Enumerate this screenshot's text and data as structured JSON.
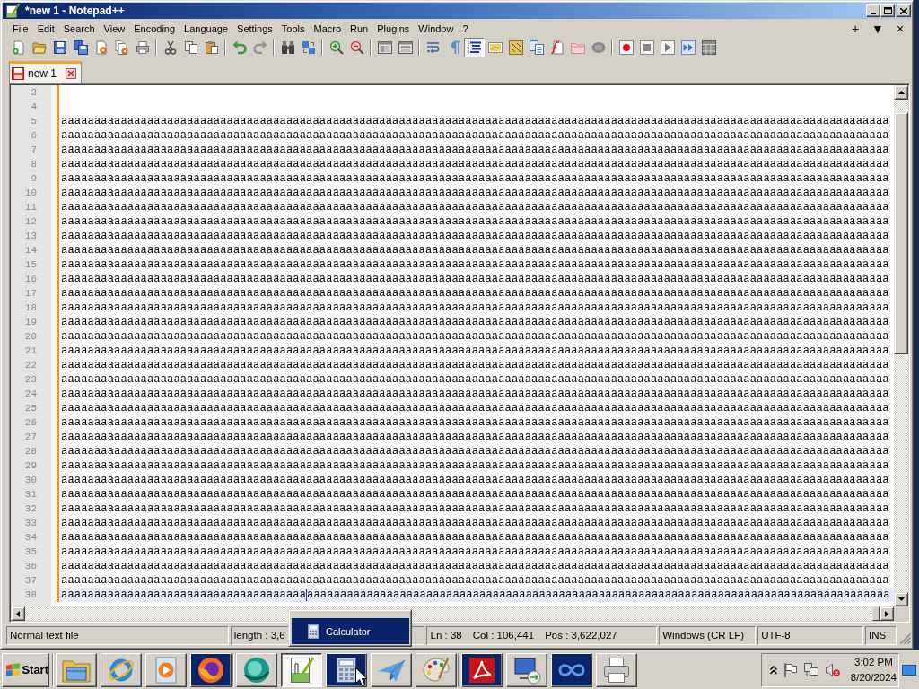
{
  "window": {
    "title": "*new 1 - Notepad++"
  },
  "menu": {
    "items": [
      "File",
      "Edit",
      "Search",
      "View",
      "Encoding",
      "Language",
      "Settings",
      "Tools",
      "Macro",
      "Run",
      "Plugins",
      "Window",
      "?"
    ],
    "tab_controls": [
      "+",
      "▼",
      "×"
    ]
  },
  "toolbar": {
    "groups": [
      [
        {
          "kind": "new",
          "disabled": false,
          "pressed": false
        },
        {
          "kind": "open",
          "disabled": false,
          "pressed": false
        },
        {
          "kind": "save",
          "disabled": false,
          "pressed": false
        },
        {
          "kind": "saveall",
          "disabled": false,
          "pressed": false
        },
        {
          "kind": "close",
          "disabled": false,
          "pressed": false
        },
        {
          "kind": "closeall",
          "disabled": false,
          "pressed": false
        },
        {
          "kind": "print",
          "disabled": false,
          "pressed": false
        }
      ],
      [
        {
          "kind": "cut",
          "disabled": false,
          "pressed": false
        },
        {
          "kind": "copy",
          "disabled": false,
          "pressed": false
        },
        {
          "kind": "paste",
          "disabled": false,
          "pressed": false
        }
      ],
      [
        {
          "kind": "undo",
          "disabled": false,
          "pressed": false
        },
        {
          "kind": "redo",
          "disabled": true,
          "pressed": false
        }
      ],
      [
        {
          "kind": "find",
          "disabled": false,
          "pressed": false
        },
        {
          "kind": "replace",
          "disabled": false,
          "pressed": false
        }
      ],
      [
        {
          "kind": "zoomin",
          "disabled": false,
          "pressed": false
        },
        {
          "kind": "zoomout",
          "disabled": false,
          "pressed": false
        }
      ],
      [
        {
          "kind": "syncv",
          "disabled": false,
          "pressed": false
        },
        {
          "kind": "synch",
          "disabled": false,
          "pressed": false
        }
      ],
      [
        {
          "kind": "wrap",
          "disabled": false,
          "pressed": false
        },
        {
          "kind": "allchars",
          "disabled": false,
          "pressed": false
        },
        {
          "kind": "indent",
          "disabled": false,
          "pressed": true
        },
        {
          "kind": "udl",
          "disabled": false,
          "pressed": false
        },
        {
          "kind": "docmap",
          "disabled": false,
          "pressed": false
        },
        {
          "kind": "doclist",
          "disabled": false,
          "pressed": false
        },
        {
          "kind": "funclist",
          "disabled": false,
          "pressed": false
        },
        {
          "kind": "workspace",
          "disabled": false,
          "pressed": false
        },
        {
          "kind": "monitor",
          "disabled": false,
          "pressed": false
        }
      ],
      [
        {
          "kind": "record",
          "disabled": false,
          "pressed": false
        },
        {
          "kind": "stop",
          "disabled": false,
          "pressed": false
        },
        {
          "kind": "play",
          "disabled": false,
          "pressed": false
        },
        {
          "kind": "playmulti",
          "disabled": false,
          "pressed": false
        },
        {
          "kind": "savemacro",
          "disabled": false,
          "pressed": false
        }
      ]
    ]
  },
  "tabs": [
    {
      "label": "new 1",
      "selected": true,
      "modified": true
    }
  ],
  "editor": {
    "lines": [
      {
        "number": "3",
        "modified": true,
        "current": false
      },
      {
        "number": "4",
        "modified": true,
        "current": false
      },
      {
        "number": "5",
        "text": "aaaaaaaaaaaaaaaaaaaaaaaaaaaaaaaaaaaaaaaaaaaaaaaaaaaaaaaaaaaaaaaaaaaaaaaaaaaaaaaaaaaaaaaaaaaaaaaaaaaaaaaaaaaaaaaaaaaaaaaaaaaaa",
        "modified": true,
        "current": false
      },
      {
        "number": "6",
        "text": "aaaaaaaaaaaaaaaaaaaaaaaaaaaaaaaaaaaaaaaaaaaaaaaaaaaaaaaaaaaaaaaaaaaaaaaaaaaaaaaaaaaaaaaaaaaaaaaaaaaaaaaaaaaaaaaaaaaaaaaaaaaaa",
        "modified": true,
        "current": false
      },
      {
        "number": "7",
        "text": "aaaaaaaaaaaaaaaaaaaaaaaaaaaaaaaaaaaaaaaaaaaaaaaaaaaaaaaaaaaaaaaaaaaaaaaaaaaaaaaaaaaaaaaaaaaaaaaaaaaaaaaaaaaaaaaaaaaaaaaaaaaaa",
        "modified": true,
        "current": false
      },
      {
        "number": "8",
        "text": "aaaaaaaaaaaaaaaaaaaaaaaaaaaaaaaaaaaaaaaaaaaaaaaaaaaaaaaaaaaaaaaaaaaaaaaaaaaaaaaaaaaaaaaaaaaaaaaaaaaaaaaaaaaaaaaaaaaaaaaaaaaaa",
        "modified": true,
        "current": false
      },
      {
        "number": "9",
        "text": "aaaaaaaaaaaaaaaaaaaaaaaaaaaaaaaaaaaaaaaaaaaaaaaaaaaaaaaaaaaaaaaaaaaaaaaaaaaaaaaaaaaaaaaaaaaaaaaaaaaaaaaaaaaaaaaaaaaaaaaaaaaaa",
        "modified": true,
        "current": false
      },
      {
        "number": "10",
        "text": "aaaaaaaaaaaaaaaaaaaaaaaaaaaaaaaaaaaaaaaaaaaaaaaaaaaaaaaaaaaaaaaaaaaaaaaaaaaaaaaaaaaaaaaaaaaaaaaaaaaaaaaaaaaaaaaaaaaaaaaaaaaaa",
        "modified": true,
        "current": false
      },
      {
        "number": "11",
        "text": "aaaaaaaaaaaaaaaaaaaaaaaaaaaaaaaaaaaaaaaaaaaaaaaaaaaaaaaaaaaaaaaaaaaaaaaaaaaaaaaaaaaaaaaaaaaaaaaaaaaaaaaaaaaaaaaaaaaaaaaaaaaaa",
        "modified": true,
        "current": false
      },
      {
        "number": "12",
        "text": "aaaaaaaaaaaaaaaaaaaaaaaaaaaaaaaaaaaaaaaaaaaaaaaaaaaaaaaaaaaaaaaaaaaaaaaaaaaaaaaaaaaaaaaaaaaaaaaaaaaaaaaaaaaaaaaaaaaaaaaaaaaaa",
        "modified": true,
        "current": false
      },
      {
        "number": "13",
        "text": "aaaaaaaaaaaaaaaaaaaaaaaaaaaaaaaaaaaaaaaaaaaaaaaaaaaaaaaaaaaaaaaaaaaaaaaaaaaaaaaaaaaaaaaaaaaaaaaaaaaaaaaaaaaaaaaaaaaaaaaaaaaaa",
        "modified": true,
        "current": false
      },
      {
        "number": "14",
        "text": "aaaaaaaaaaaaaaaaaaaaaaaaaaaaaaaaaaaaaaaaaaaaaaaaaaaaaaaaaaaaaaaaaaaaaaaaaaaaaaaaaaaaaaaaaaaaaaaaaaaaaaaaaaaaaaaaaaaaaaaaaaaaa",
        "modified": true,
        "current": false
      },
      {
        "number": "15",
        "text": "aaaaaaaaaaaaaaaaaaaaaaaaaaaaaaaaaaaaaaaaaaaaaaaaaaaaaaaaaaaaaaaaaaaaaaaaaaaaaaaaaaaaaaaaaaaaaaaaaaaaaaaaaaaaaaaaaaaaaaaaaaaaa",
        "modified": true,
        "current": false
      },
      {
        "number": "16",
        "text": "aaaaaaaaaaaaaaaaaaaaaaaaaaaaaaaaaaaaaaaaaaaaaaaaaaaaaaaaaaaaaaaaaaaaaaaaaaaaaaaaaaaaaaaaaaaaaaaaaaaaaaaaaaaaaaaaaaaaaaaaaaaaa",
        "modified": true,
        "current": false
      },
      {
        "number": "17",
        "text": "aaaaaaaaaaaaaaaaaaaaaaaaaaaaaaaaaaaaaaaaaaaaaaaaaaaaaaaaaaaaaaaaaaaaaaaaaaaaaaaaaaaaaaaaaaaaaaaaaaaaaaaaaaaaaaaaaaaaaaaaaaaaa",
        "modified": true,
        "current": false
      },
      {
        "number": "18",
        "text": "aaaaaaaaaaaaaaaaaaaaaaaaaaaaaaaaaaaaaaaaaaaaaaaaaaaaaaaaaaaaaaaaaaaaaaaaaaaaaaaaaaaaaaaaaaaaaaaaaaaaaaaaaaaaaaaaaaaaaaaaaaaaa",
        "modified": true,
        "current": false
      },
      {
        "number": "19",
        "text": "aaaaaaaaaaaaaaaaaaaaaaaaaaaaaaaaaaaaaaaaaaaaaaaaaaaaaaaaaaaaaaaaaaaaaaaaaaaaaaaaaaaaaaaaaaaaaaaaaaaaaaaaaaaaaaaaaaaaaaaaaaaaa",
        "modified": true,
        "current": false
      },
      {
        "number": "20",
        "text": "aaaaaaaaaaaaaaaaaaaaaaaaaaaaaaaaaaaaaaaaaaaaaaaaaaaaaaaaaaaaaaaaaaaaaaaaaaaaaaaaaaaaaaaaaaaaaaaaaaaaaaaaaaaaaaaaaaaaaaaaaaaaa",
        "modified": true,
        "current": false
      },
      {
        "number": "21",
        "text": "aaaaaaaaaaaaaaaaaaaaaaaaaaaaaaaaaaaaaaaaaaaaaaaaaaaaaaaaaaaaaaaaaaaaaaaaaaaaaaaaaaaaaaaaaaaaaaaaaaaaaaaaaaaaaaaaaaaaaaaaaaaaa",
        "modified": true,
        "current": false
      },
      {
        "number": "22",
        "text": "aaaaaaaaaaaaaaaaaaaaaaaaaaaaaaaaaaaaaaaaaaaaaaaaaaaaaaaaaaaaaaaaaaaaaaaaaaaaaaaaaaaaaaaaaaaaaaaaaaaaaaaaaaaaaaaaaaaaaaaaaaaaa",
        "modified": true,
        "current": false
      },
      {
        "number": "23",
        "text": "aaaaaaaaaaaaaaaaaaaaaaaaaaaaaaaaaaaaaaaaaaaaaaaaaaaaaaaaaaaaaaaaaaaaaaaaaaaaaaaaaaaaaaaaaaaaaaaaaaaaaaaaaaaaaaaaaaaaaaaaaaaaa",
        "modified": true,
        "current": false
      },
      {
        "number": "24",
        "text": "aaaaaaaaaaaaaaaaaaaaaaaaaaaaaaaaaaaaaaaaaaaaaaaaaaaaaaaaaaaaaaaaaaaaaaaaaaaaaaaaaaaaaaaaaaaaaaaaaaaaaaaaaaaaaaaaaaaaaaaaaaaaa",
        "modified": true,
        "current": false
      },
      {
        "number": "25",
        "text": "aaaaaaaaaaaaaaaaaaaaaaaaaaaaaaaaaaaaaaaaaaaaaaaaaaaaaaaaaaaaaaaaaaaaaaaaaaaaaaaaaaaaaaaaaaaaaaaaaaaaaaaaaaaaaaaaaaaaaaaaaaaaa",
        "modified": true,
        "current": false
      },
      {
        "number": "26",
        "text": "aaaaaaaaaaaaaaaaaaaaaaaaaaaaaaaaaaaaaaaaaaaaaaaaaaaaaaaaaaaaaaaaaaaaaaaaaaaaaaaaaaaaaaaaaaaaaaaaaaaaaaaaaaaaaaaaaaaaaaaaaaaaa",
        "modified": true,
        "current": false
      },
      {
        "number": "27",
        "text": "aaaaaaaaaaaaaaaaaaaaaaaaaaaaaaaaaaaaaaaaaaaaaaaaaaaaaaaaaaaaaaaaaaaaaaaaaaaaaaaaaaaaaaaaaaaaaaaaaaaaaaaaaaaaaaaaaaaaaaaaaaaaa",
        "modified": true,
        "current": false
      },
      {
        "number": "28",
        "text": "aaaaaaaaaaaaaaaaaaaaaaaaaaaaaaaaaaaaaaaaaaaaaaaaaaaaaaaaaaaaaaaaaaaaaaaaaaaaaaaaaaaaaaaaaaaaaaaaaaaaaaaaaaaaaaaaaaaaaaaaaaaaa",
        "modified": true,
        "current": false
      },
      {
        "number": "29",
        "text": "aaaaaaaaaaaaaaaaaaaaaaaaaaaaaaaaaaaaaaaaaaaaaaaaaaaaaaaaaaaaaaaaaaaaaaaaaaaaaaaaaaaaaaaaaaaaaaaaaaaaaaaaaaaaaaaaaaaaaaaaaaaaa",
        "modified": true,
        "current": false
      },
      {
        "number": "30",
        "text": "aaaaaaaaaaaaaaaaaaaaaaaaaaaaaaaaaaaaaaaaaaaaaaaaaaaaaaaaaaaaaaaaaaaaaaaaaaaaaaaaaaaaaaaaaaaaaaaaaaaaaaaaaaaaaaaaaaaaaaaaaaaaa",
        "modified": true,
        "current": false
      },
      {
        "number": "31",
        "text": "aaaaaaaaaaaaaaaaaaaaaaaaaaaaaaaaaaaaaaaaaaaaaaaaaaaaaaaaaaaaaaaaaaaaaaaaaaaaaaaaaaaaaaaaaaaaaaaaaaaaaaaaaaaaaaaaaaaaaaaaaaaaa",
        "modified": true,
        "current": false
      },
      {
        "number": "32",
        "text": "aaaaaaaaaaaaaaaaaaaaaaaaaaaaaaaaaaaaaaaaaaaaaaaaaaaaaaaaaaaaaaaaaaaaaaaaaaaaaaaaaaaaaaaaaaaaaaaaaaaaaaaaaaaaaaaaaaaaaaaaaaaaa",
        "modified": true,
        "current": false
      },
      {
        "number": "33",
        "text": "aaaaaaaaaaaaaaaaaaaaaaaaaaaaaaaaaaaaaaaaaaaaaaaaaaaaaaaaaaaaaaaaaaaaaaaaaaaaaaaaaaaaaaaaaaaaaaaaaaaaaaaaaaaaaaaaaaaaaaaaaaaaa",
        "modified": true,
        "current": false
      },
      {
        "number": "34",
        "text": "aaaaaaaaaaaaaaaaaaaaaaaaaaaaaaaaaaaaaaaaaaaaaaaaaaaaaaaaaaaaaaaaaaaaaaaaaaaaaaaaaaaaaaaaaaaaaaaaaaaaaaaaaaaaaaaaaaaaaaaaaaaaa",
        "modified": true,
        "current": false
      },
      {
        "number": "35",
        "text": "aaaaaaaaaaaaaaaaaaaaaaaaaaaaaaaaaaaaaaaaaaaaaaaaaaaaaaaaaaaaaaaaaaaaaaaaaaaaaaaaaaaaaaaaaaaaaaaaaaaaaaaaaaaaaaaaaaaaaaaaaaaaa",
        "modified": true,
        "current": false
      },
      {
        "number": "36",
        "text": "aaaaaaaaaaaaaaaaaaaaaaaaaaaaaaaaaaaaaaaaaaaaaaaaaaaaaaaaaaaaaaaaaaaaaaaaaaaaaaaaaaaaaaaaaaaaaaaaaaaaaaaaaaaaaaaaaaaaaaaaaaaaa",
        "modified": true,
        "current": false
      },
      {
        "number": "37",
        "text": "aaaaaaaaaaaaaaaaaaaaaaaaaaaaaaaaaaaaaaaaaaaaaaaaaaaaaaaaaaaaaaaaaaaaaaaaaaaaaaaaaaaaaaaaaaaaaaaaaaaaaaaaaaaaaaaaaaaaaaaaaaaaa",
        "modified": true,
        "current": false
      },
      {
        "number": "38",
        "text": "aaaaaaaaaaaaaaaaaaaaaaaaaaaaaaaaaaaaa",
        "after_caret": "aaaaaaaaaaaaaaaaaaaaaaaaaaaaaaaaaaaaaaaaaaaaaaaaaaaaaaaaaaaaaaaaaaaaaaaaaaaaaaaaaaaaaaaa",
        "modified": true,
        "current": true
      }
    ]
  },
  "status_bar": {
    "file_type": "Normal text file",
    "length": "length : 3,6",
    "position": [
      "Ln : 38",
      "Col : 106,441",
      "Pos : 3,622,027"
    ],
    "eol": "Windows (CR LF)",
    "encoding": "UTF-8",
    "mode": "INS"
  },
  "taskbar_popup": {
    "items": [
      {
        "label": "Calculator",
        "selected": true
      }
    ]
  },
  "taskbar": {
    "start": "Start",
    "groups": [
      [
        {
          "kind": "folder",
          "pressed": false,
          "highlighted": false
        },
        {
          "kind": "ie",
          "pressed": false,
          "highlighted": false
        },
        {
          "kind": "media",
          "pressed": false,
          "highlighted": false
        },
        {
          "kind": "firefox",
          "pressed": false,
          "highlighted": true
        }
      ],
      [
        {
          "kind": "sphere",
          "pressed": false,
          "highlighted": false
        },
        {
          "kind": "notepad",
          "pressed": true,
          "highlighted": false
        },
        {
          "kind": "calculator",
          "pressed": false,
          "highlighted": true
        },
        {
          "kind": "plane",
          "pressed": false,
          "highlighted": false
        },
        {
          "kind": "palette",
          "pressed": false,
          "highlighted": false
        }
      ],
      [
        {
          "kind": "pdf",
          "pressed": false,
          "highlighted": true
        },
        {
          "kind": "remote",
          "pressed": false,
          "highlighted": false
        },
        {
          "kind": "infinity",
          "pressed": false,
          "highlighted": true
        },
        {
          "kind": "printer",
          "pressed": false,
          "highlighted": false
        }
      ]
    ],
    "clock": {
      "time": "3:02 PM",
      "date": "8/20/2024"
    }
  }
}
